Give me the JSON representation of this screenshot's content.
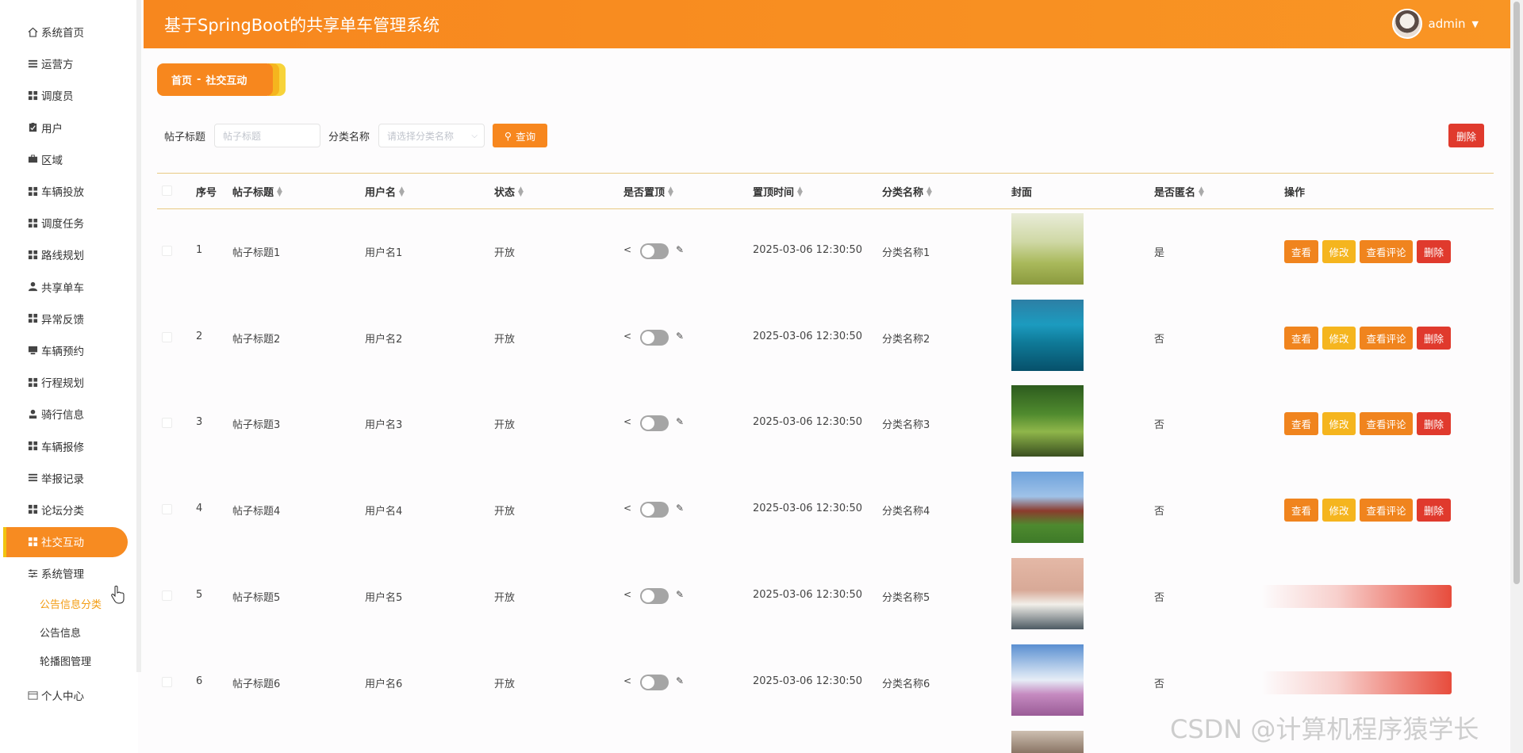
{
  "app": {
    "title": "基于SpringBoot的共享单车管理系统"
  },
  "user": {
    "name": "admin"
  },
  "sidebar": {
    "items": [
      {
        "label": "系统首页",
        "icon": "home-icon"
      },
      {
        "label": "运营方",
        "icon": "list-icon"
      },
      {
        "label": "调度员",
        "icon": "grid-icon"
      },
      {
        "label": "用户",
        "icon": "clipboard-icon"
      },
      {
        "label": "区域",
        "icon": "briefcase-icon"
      },
      {
        "label": "车辆投放",
        "icon": "grid-icon"
      },
      {
        "label": "调度任务",
        "icon": "grid-icon"
      },
      {
        "label": "路线规划",
        "icon": "grid-icon"
      },
      {
        "label": "共享单车",
        "icon": "person-icon"
      },
      {
        "label": "异常反馈",
        "icon": "grid-icon"
      },
      {
        "label": "车辆预约",
        "icon": "monitor-icon"
      },
      {
        "label": "行程规划",
        "icon": "grid-icon"
      },
      {
        "label": "骑行信息",
        "icon": "user-icon"
      },
      {
        "label": "车辆报修",
        "icon": "grid-icon"
      },
      {
        "label": "举报记录",
        "icon": "list-icon"
      },
      {
        "label": "论坛分类",
        "icon": "grid-icon"
      },
      {
        "label": "社交互动",
        "icon": "grid-icon"
      },
      {
        "label": "系统管理",
        "icon": "sliders-icon"
      }
    ],
    "submenu": [
      "公告信息分类",
      "公告信息",
      "轮播图管理"
    ],
    "personal": {
      "label": "个人中心",
      "icon": "card-icon"
    }
  },
  "breadcrumb": {
    "home": "首页",
    "separator": "-",
    "current": "社交互动"
  },
  "search": {
    "title_label": "帖子标题",
    "title_placeholder": "帖子标题",
    "category_label": "分类名称",
    "category_placeholder": "请选择分类名称",
    "query_button": "查询",
    "delete_button": "删除"
  },
  "table": {
    "headers": [
      "序号",
      "帖子标题",
      "用户名",
      "状态",
      "是否置顶",
      "置顶时间",
      "分类名称",
      "封面",
      "是否匿名",
      "操作"
    ],
    "rows": [
      {
        "no": "1",
        "title": "帖子标题1",
        "user": "用户名1",
        "status": "开放",
        "time": "2025-03-06 12:30:50",
        "category": "分类名称1",
        "anon": "是"
      },
      {
        "no": "2",
        "title": "帖子标题2",
        "user": "用户名2",
        "status": "开放",
        "time": "2025-03-06 12:30:50",
        "category": "分类名称2",
        "anon": "否"
      },
      {
        "no": "3",
        "title": "帖子标题3",
        "user": "用户名3",
        "status": "开放",
        "time": "2025-03-06 12:30:50",
        "category": "分类名称3",
        "anon": "否"
      },
      {
        "no": "4",
        "title": "帖子标题4",
        "user": "用户名4",
        "status": "开放",
        "time": "2025-03-06 12:30:50",
        "category": "分类名称4",
        "anon": "否"
      },
      {
        "no": "5",
        "title": "帖子标题5",
        "user": "用户名5",
        "status": "开放",
        "time": "2025-03-06 12:30:50",
        "category": "分类名称5",
        "anon": "否"
      },
      {
        "no": "6",
        "title": "帖子标题6",
        "user": "用户名6",
        "status": "开放",
        "time": "2025-03-06 12:30:50",
        "category": "分类名称6",
        "anon": "否"
      }
    ],
    "actions": {
      "view": "查看",
      "edit": "修改",
      "comments": "查看评论",
      "delete": "删除"
    }
  },
  "watermark": "CSDN @计算机程序猿学长",
  "colors": {
    "accent": "#f7871e",
    "danger": "#e03a2d",
    "edit": "#f5b51e"
  }
}
